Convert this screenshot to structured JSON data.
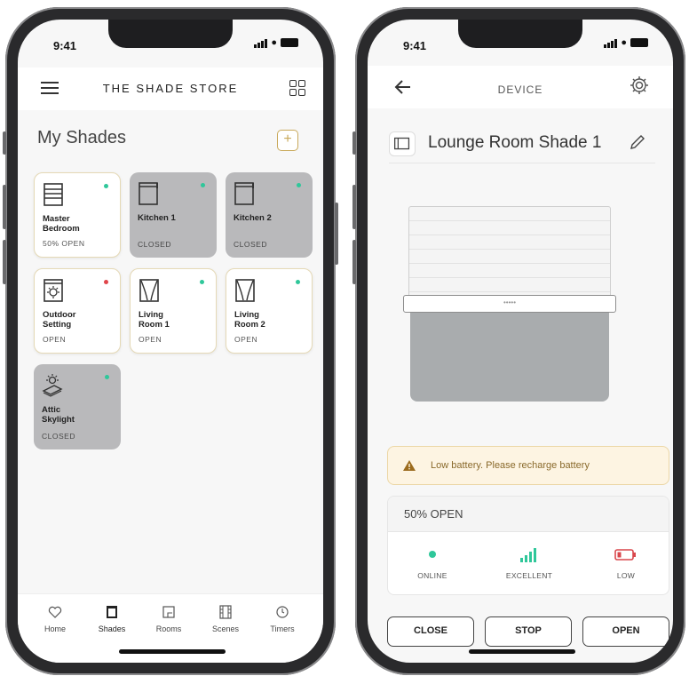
{
  "left": {
    "status_time": "9:41",
    "brand": "THE SHADE STORE",
    "title": "My Shades",
    "add_label": "+",
    "tiles": [
      {
        "name": "Master\nBedroom",
        "state": "50% OPEN",
        "icon": "roman-shade-icon",
        "status": "on",
        "dot": "#2fc79a"
      },
      {
        "name": "Kitchen 1",
        "state": "CLOSED",
        "icon": "roller-shade-icon",
        "status": "off",
        "dot": "#2fc79a"
      },
      {
        "name": "Kitchen 2",
        "state": "CLOSED",
        "icon": "roller-shade-icon",
        "status": "off",
        "dot": "#2fc79a"
      },
      {
        "name": "Outdoor\nSetting",
        "state": "OPEN",
        "icon": "outdoor-shade-icon",
        "status": "on",
        "dot": "#e0454a"
      },
      {
        "name": "Living\nRoom 1",
        "state": "OPEN",
        "icon": "drapery-icon",
        "status": "on",
        "dot": "#2fc79a"
      },
      {
        "name": "Living\nRoom 2",
        "state": "OPEN",
        "icon": "drapery-icon",
        "status": "on",
        "dot": "#2fc79a"
      },
      {
        "name": "Attic\nSkylight",
        "state": "CLOSED",
        "icon": "skylight-icon",
        "status": "off",
        "dot": "#2fc79a"
      }
    ],
    "tabs": [
      {
        "label": "Home",
        "icon": "heart-icon"
      },
      {
        "label": "Shades",
        "icon": "shade-icon"
      },
      {
        "label": "Rooms",
        "icon": "room-icon"
      },
      {
        "label": "Scenes",
        "icon": "scene-icon"
      },
      {
        "label": "Timers",
        "icon": "clock-icon"
      }
    ]
  },
  "right": {
    "status_time": "9:41",
    "header_title": "DEVICE",
    "shade_name": "Lounge Room Shade 1",
    "alert_text": "Low battery. Please recharge battery",
    "position_text": "50% OPEN",
    "position_fraction": 0.5,
    "stats": [
      {
        "label": "ONLINE",
        "icon": "online-dot-icon",
        "color": "#2fc79a"
      },
      {
        "label": "EXCELLENT",
        "icon": "signal-bars-icon",
        "color": "#2fc79a"
      },
      {
        "label": "LOW",
        "icon": "battery-low-icon",
        "color": "#d9474c"
      }
    ],
    "controls": [
      "CLOSE",
      "STOP",
      "OPEN"
    ]
  },
  "colors": {
    "accent_gold": "#c9a95a",
    "online": "#2fc79a",
    "alert": "#d9474c"
  }
}
